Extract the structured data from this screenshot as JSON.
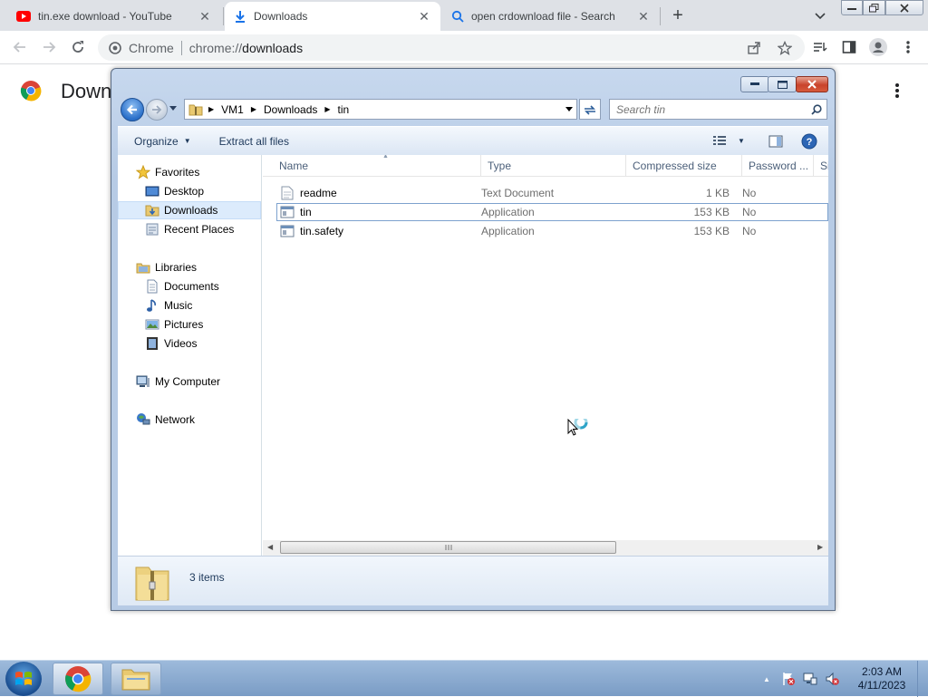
{
  "browser": {
    "tabs": [
      {
        "title": "tin.exe download - YouTube",
        "icon": "youtube-icon"
      },
      {
        "title": "Downloads",
        "icon": "download-icon"
      },
      {
        "title": "open crdownload file - Search",
        "icon": "search-icon"
      }
    ],
    "omnibox": {
      "site_label": "Chrome",
      "url_prefix": "chrome://",
      "url_host": "downloads"
    },
    "page_heading": "Down"
  },
  "explorer": {
    "breadcrumb": [
      "VM1",
      "Downloads",
      "tin"
    ],
    "search_placeholder": "Search tin",
    "commands": {
      "organize": "Organize",
      "extract": "Extract all files"
    },
    "nav": {
      "favorites": "Favorites",
      "desktop": "Desktop",
      "downloads": "Downloads",
      "recent": "Recent Places",
      "libraries": "Libraries",
      "documents": "Documents",
      "music": "Music",
      "pictures": "Pictures",
      "videos": "Videos",
      "computer": "My Computer",
      "network": "Network"
    },
    "columns": {
      "name": "Name",
      "type": "Type",
      "compressed": "Compressed size",
      "password": "Password ...",
      "size": "Si"
    },
    "files": [
      {
        "name": "readme",
        "type": "Text Document",
        "compressed": "1 KB",
        "password": "No",
        "icon": "text-file-icon"
      },
      {
        "name": "tin",
        "type": "Application",
        "compressed": "153 KB",
        "password": "No",
        "icon": "application-icon"
      },
      {
        "name": "tin.safety",
        "type": "Application",
        "compressed": "153 KB",
        "password": "No",
        "icon": "application-icon"
      }
    ],
    "item_count": "3 items"
  },
  "taskbar": {
    "time": "2:03 AM",
    "date": "4/11/2023"
  },
  "colors": {
    "chrome_tabstrip": "#dee1e6",
    "explorer_frame": "#b7cbe5",
    "taskbar": "#8aaad0",
    "selection": "#dcebfc"
  }
}
